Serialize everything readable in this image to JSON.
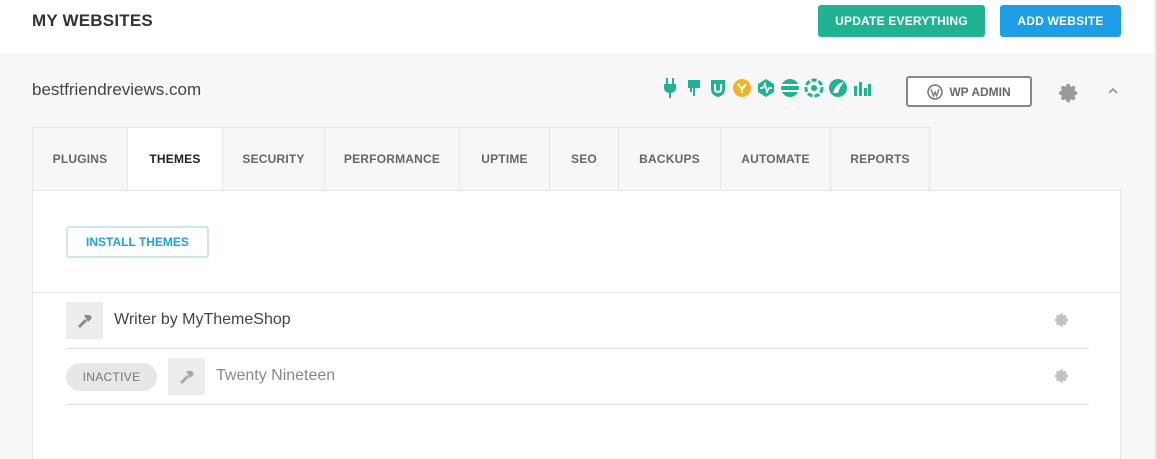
{
  "header": {
    "title": "MY WEBSITES",
    "update_label": "UPDATE EVERYTHING",
    "add_label": "ADD WEBSITE",
    "colors": {
      "update": "#20b393",
      "add": "#1e9ee6"
    }
  },
  "site": {
    "name": "bestfriendreviews.com",
    "wp_admin_label": "WP ADMIN",
    "status_icons": [
      "plugin-icon",
      "plugin-alt-icon",
      "security-shield-icon",
      "performance-icon",
      "uptime-icon",
      "seo-icon",
      "backups-icon",
      "automate-icon",
      "reports-icon"
    ],
    "icon_colors": {
      "primary": "#20b393",
      "accent": "#f0b323"
    }
  },
  "tabs": [
    {
      "label": "PLUGINS"
    },
    {
      "label": "THEMES",
      "active": true
    },
    {
      "label": "SECURITY"
    },
    {
      "label": "PERFORMANCE"
    },
    {
      "label": "UPTIME"
    },
    {
      "label": "SEO"
    },
    {
      "label": "BACKUPS"
    },
    {
      "label": "AUTOMATE"
    },
    {
      "label": "REPORTS"
    }
  ],
  "themes_panel": {
    "install_label": "INSTALL THEMES",
    "themes": [
      {
        "name": "Writer by MyThemeShop",
        "status": ""
      },
      {
        "name": "Twenty Nineteen",
        "status": "INACTIVE"
      }
    ]
  }
}
